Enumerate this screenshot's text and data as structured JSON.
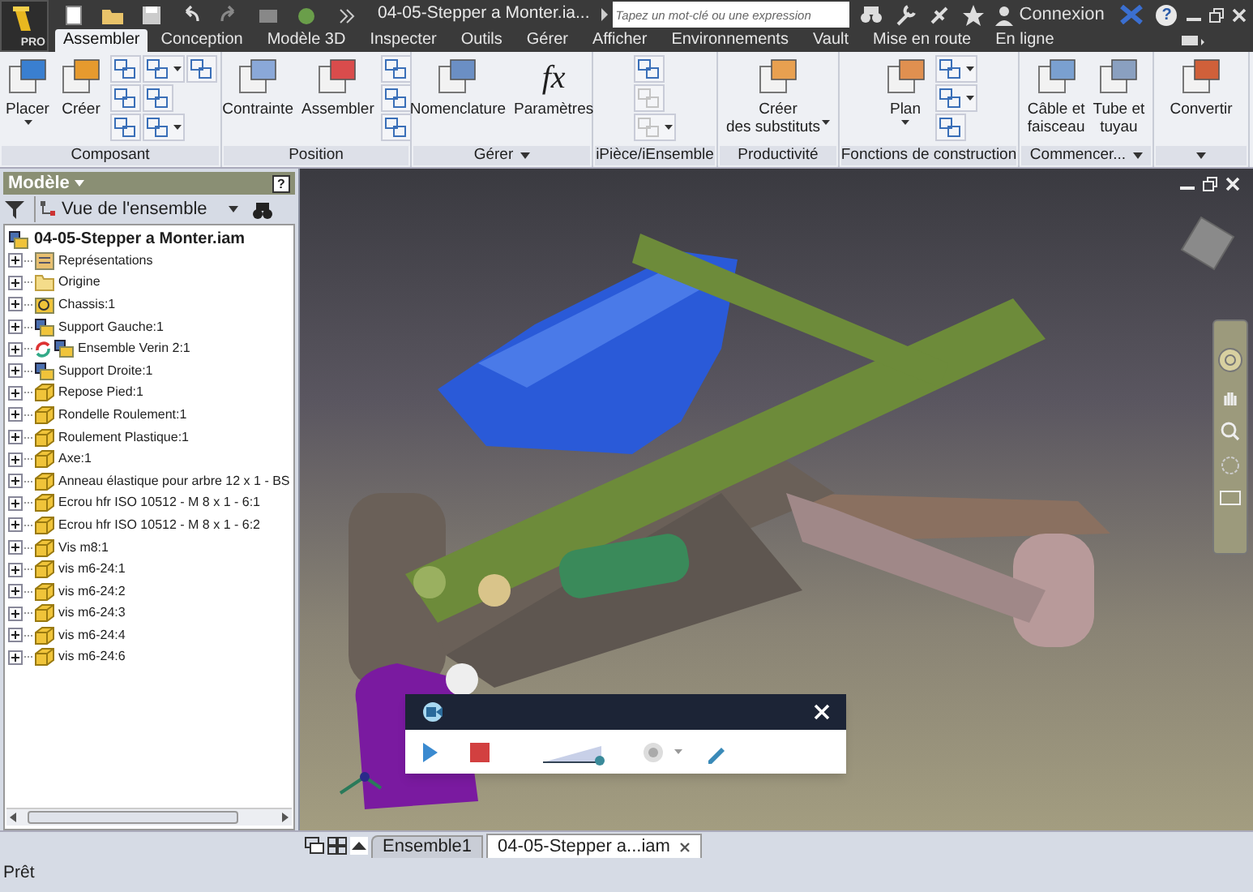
{
  "app_button": {
    "badge": "PRO"
  },
  "title_bar": {
    "title": "04-05-Stepper a Monter.ia...",
    "search": {
      "placeholder": "Tapez un mot-clé ou une expression"
    },
    "sign_in": "Connexion",
    "help": "?"
  },
  "tabs": [
    {
      "label": "Assembler",
      "selected": true
    },
    {
      "label": "Conception",
      "selected": false
    },
    {
      "label": "Modèle 3D",
      "selected": false
    },
    {
      "label": "Inspecter",
      "selected": false
    },
    {
      "label": "Outils",
      "selected": false
    },
    {
      "label": "Gérer",
      "selected": false
    },
    {
      "label": "Afficher",
      "selected": false
    },
    {
      "label": "Environnements",
      "selected": false
    },
    {
      "label": "Vault",
      "selected": false
    },
    {
      "label": "Mise en route",
      "selected": false
    },
    {
      "label": "En ligne",
      "selected": false
    }
  ],
  "ribbon": [
    {
      "label": "Composant",
      "menu": false,
      "items": [
        {
          "kind": "large",
          "lines": [
            "Placer"
          ],
          "dropdown": true
        },
        {
          "kind": "large",
          "lines": [
            "Créer"
          ],
          "dropdown": false
        },
        {
          "kind": "small",
          "rows": [
            [
              {
                "dropdown": false,
                "disabled": false
              },
              {
                "dropdown": true,
                "disabled": false
              },
              {
                "dropdown": false,
                "disabled": false
              }
            ],
            [
              {
                "dropdown": false,
                "disabled": false
              },
              {
                "dropdown": false,
                "disabled": false
              }
            ],
            [
              {
                "dropdown": false,
                "disabled": false
              },
              {
                "dropdown": true,
                "disabled": false
              }
            ]
          ]
        }
      ]
    },
    {
      "label": "Position",
      "menu": false,
      "items": [
        {
          "kind": "large",
          "lines": [
            "Contrainte"
          ],
          "dropdown": false
        },
        {
          "kind": "large",
          "lines": [
            "Assembler"
          ],
          "dropdown": false
        },
        {
          "kind": "small",
          "rows": [
            [
              {
                "dropdown": false,
                "disabled": false
              }
            ],
            [
              {
                "dropdown": false,
                "disabled": false
              }
            ],
            [
              {
                "dropdown": false,
                "disabled": false
              }
            ]
          ]
        }
      ]
    },
    {
      "label": "Gérer",
      "menu": true,
      "items": [
        {
          "kind": "large",
          "lines": [
            "Nomenclature"
          ],
          "dropdown": false
        },
        {
          "kind": "large",
          "lines": [
            "Paramètres"
          ],
          "dropdown": false,
          "glyph": "fx"
        }
      ]
    },
    {
      "label": "iPièce/iEnsemble",
      "menu": false,
      "items": [
        {
          "kind": "small",
          "rows": [
            [
              {
                "dropdown": false,
                "disabled": false
              }
            ],
            [
              {
                "dropdown": false,
                "disabled": true
              }
            ],
            [
              {
                "dropdown": true,
                "disabled": true
              }
            ]
          ]
        }
      ]
    },
    {
      "label": "Productivité",
      "menu": false,
      "items": [
        {
          "kind": "large",
          "lines": [
            "Créer",
            "des substituts"
          ],
          "dropdown": true
        }
      ]
    },
    {
      "label": "Fonctions de construction",
      "menu": false,
      "items": [
        {
          "kind": "large",
          "lines": [
            "Plan"
          ],
          "dropdown": true
        },
        {
          "kind": "small",
          "rows": [
            [
              {
                "dropdown": true,
                "disabled": false
              }
            ],
            [
              {
                "dropdown": true,
                "disabled": false
              }
            ],
            [
              {
                "dropdown": false,
                "disabled": false
              }
            ]
          ]
        }
      ]
    },
    {
      "label": "Commencer...",
      "menu": true,
      "items": [
        {
          "kind": "large",
          "lines": [
            "Câble et",
            "faisceau"
          ],
          "dropdown": false
        },
        {
          "kind": "large",
          "lines": [
            "Tube et",
            "tuyau"
          ],
          "dropdown": false
        }
      ]
    },
    {
      "menu": true,
      "items": [
        {
          "kind": "large",
          "lines": [
            "Convertir"
          ],
          "dropdown": false
        }
      ]
    }
  ],
  "browser": {
    "title": "Modèle",
    "help": "?",
    "view": "Vue de l'ensemble",
    "root": {
      "label": "04-05-Stepper a Monter.iam",
      "children": [
        {
          "label": "Représentations",
          "kind": "representations",
          "expanded": false
        },
        {
          "label": "Origine",
          "kind": "folder",
          "expanded": false
        },
        {
          "label": "Chassis:1",
          "kind": "weldment",
          "expanded": false
        },
        {
          "label": "Support Gauche:1",
          "kind": "assembly",
          "expanded": false
        },
        {
          "label": "Ensemble Verin 2:1",
          "kind": "adaptive",
          "expanded": false
        },
        {
          "label": "Support Droite:1",
          "kind": "assembly",
          "expanded": false
        },
        {
          "label": "Repose Pied:1",
          "kind": "part",
          "expanded": false
        },
        {
          "label": "Rondelle Roulement:1",
          "kind": "part",
          "expanded": false
        },
        {
          "label": "Roulement Plastique:1",
          "kind": "part",
          "expanded": false
        },
        {
          "label": "Axe:1",
          "kind": "part",
          "expanded": false
        },
        {
          "label": "Anneau élastique pour arbre 12 x 1 - BS",
          "kind": "part",
          "expanded": false
        },
        {
          "label": "Ecrou hfr  ISO 10512 - M 8 x 1 - 6:1",
          "kind": "part",
          "expanded": false
        },
        {
          "label": "Ecrou hfr  ISO 10512 - M 8 x 1 - 6:2",
          "kind": "part",
          "expanded": false
        },
        {
          "label": "Vis m8:1",
          "kind": "part",
          "expanded": false
        },
        {
          "label": "vis m6-24:1",
          "kind": "part",
          "expanded": false
        },
        {
          "label": "vis m6-24:2",
          "kind": "part",
          "expanded": false
        },
        {
          "label": "vis m6-24:3",
          "kind": "part",
          "expanded": false
        },
        {
          "label": "vis m6-24:4",
          "kind": "part",
          "expanded": false
        },
        {
          "label": "vis m6-24:6",
          "kind": "part",
          "expanded": false
        }
      ]
    }
  },
  "document_tabs": [
    {
      "label": "Ensemble1",
      "selected": false
    },
    {
      "label": "04-05-Stepper a...iam",
      "selected": true
    }
  ],
  "status_bar": {
    "text": "Prêt"
  }
}
